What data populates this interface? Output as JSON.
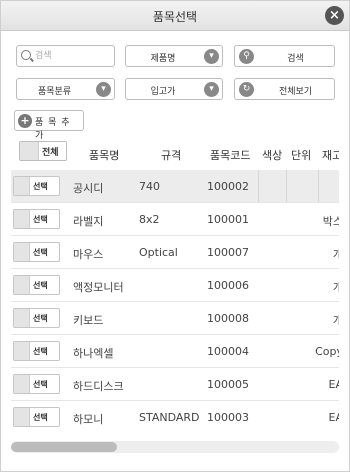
{
  "dialog": {
    "title": "품목선택",
    "close_glyph": "×"
  },
  "filters": {
    "search_placeholder": "검색",
    "search_value": "",
    "field_select": "제품명",
    "search_button": "검색",
    "category_select": "품목분류",
    "inout_select": "입고가",
    "view_all_button": "전체보기",
    "add_button": "품 목 추 가"
  },
  "icons": {
    "dropdown": "chevron-down-icon",
    "search": "search-icon",
    "refresh": "refresh-icon",
    "plus": "plus-icon",
    "close": "close-icon"
  },
  "grid": {
    "select_all_label": "전체",
    "columns": [
      "품목명",
      "규격",
      "품목코드",
      "색상",
      "단위",
      "재고"
    ],
    "select_label": "선택",
    "rows": [
      {
        "name": "공시디",
        "spec": "740",
        "code": "100002",
        "color": "",
        "unit": ""
      },
      {
        "name": "라벨지",
        "spec": "8x2",
        "code": "100001",
        "color": "",
        "unit": "박스"
      },
      {
        "name": "마우스",
        "spec": "Optical",
        "code": "100007",
        "color": "",
        "unit": "개"
      },
      {
        "name": "액정모니터",
        "spec": "",
        "code": "100006",
        "color": "",
        "unit": "개"
      },
      {
        "name": "키보드",
        "spec": "",
        "code": "100008",
        "color": "",
        "unit": "개"
      },
      {
        "name": "하나엑셀",
        "spec": "",
        "code": "100004",
        "color": "",
        "unit": "Copy"
      },
      {
        "name": "하드디스크",
        "spec": "",
        "code": "100005",
        "color": "",
        "unit": "EA"
      },
      {
        "name": "하모니",
        "spec": "STANDARD",
        "code": "100003",
        "color": "",
        "unit": "EA"
      }
    ]
  },
  "colors": {
    "header_bg": "#e6e6e6",
    "icon_gray": "#888888",
    "shade_row": "#ececec"
  }
}
